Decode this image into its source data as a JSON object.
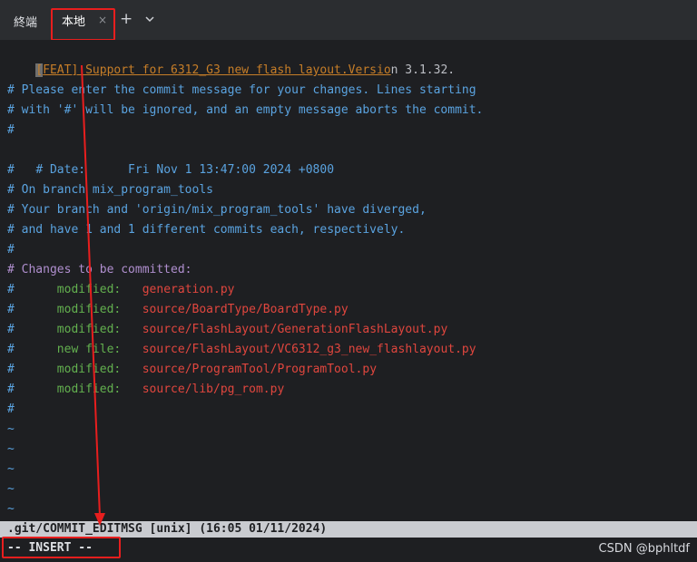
{
  "tabbar": {
    "terminal_label": "終端",
    "tab_label": "本地",
    "close_glyph": "×",
    "add_glyph": "+"
  },
  "editor": {
    "subject": {
      "cursor_char": "[",
      "highlighted": "FEAT] Support for 6312_G3 new flash layout.Versio",
      "tail": "n 3.1.32."
    },
    "comment_lines": [
      "# Please enter the commit message for your changes. Lines starting",
      "# with '#' will be ignored, and an empty message aborts the commit.",
      "#"
    ],
    "date_prefix": "# ",
    "date_label": "Date:      Fri Nov 1 13:47:00 2024 +0800",
    "hash_line": "#",
    "branch_lines": [
      "# On branch mix_program_tools",
      "# Your branch and 'origin/mix_program_tools' have diverged,",
      "# and have 1 and 1 different commits each, respectively.",
      "#",
      "# Changes to be committed:"
    ],
    "changes": [
      {
        "status": "modified:",
        "file": "generation.py"
      },
      {
        "status": "modified:",
        "file": "source/BoardType/BoardType.py"
      },
      {
        "status": "modified:",
        "file": "source/FlashLayout/GenerationFlashLayout.py"
      },
      {
        "status": "new file:",
        "file": "source/FlashLayout/VC6312_g3_new_flashlayout.py"
      },
      {
        "status": "modified:",
        "file": "source/ProgramTool/ProgramTool.py"
      },
      {
        "status": "modified:",
        "file": "source/lib/pg_rom.py"
      }
    ],
    "trailing_hash": "#",
    "tilde": "~"
  },
  "statusline": ".git/COMMIT_EDITMSG [unix] (16:05 01/11/2024)",
  "modeline": "-- INSERT --",
  "watermark": "CSDN @bphltdf",
  "colors": {
    "annotation_red": "#e81e1e",
    "comment_blue": "#5aa3e0",
    "modified_green": "#63b04f",
    "file_red": "#e0463e"
  }
}
